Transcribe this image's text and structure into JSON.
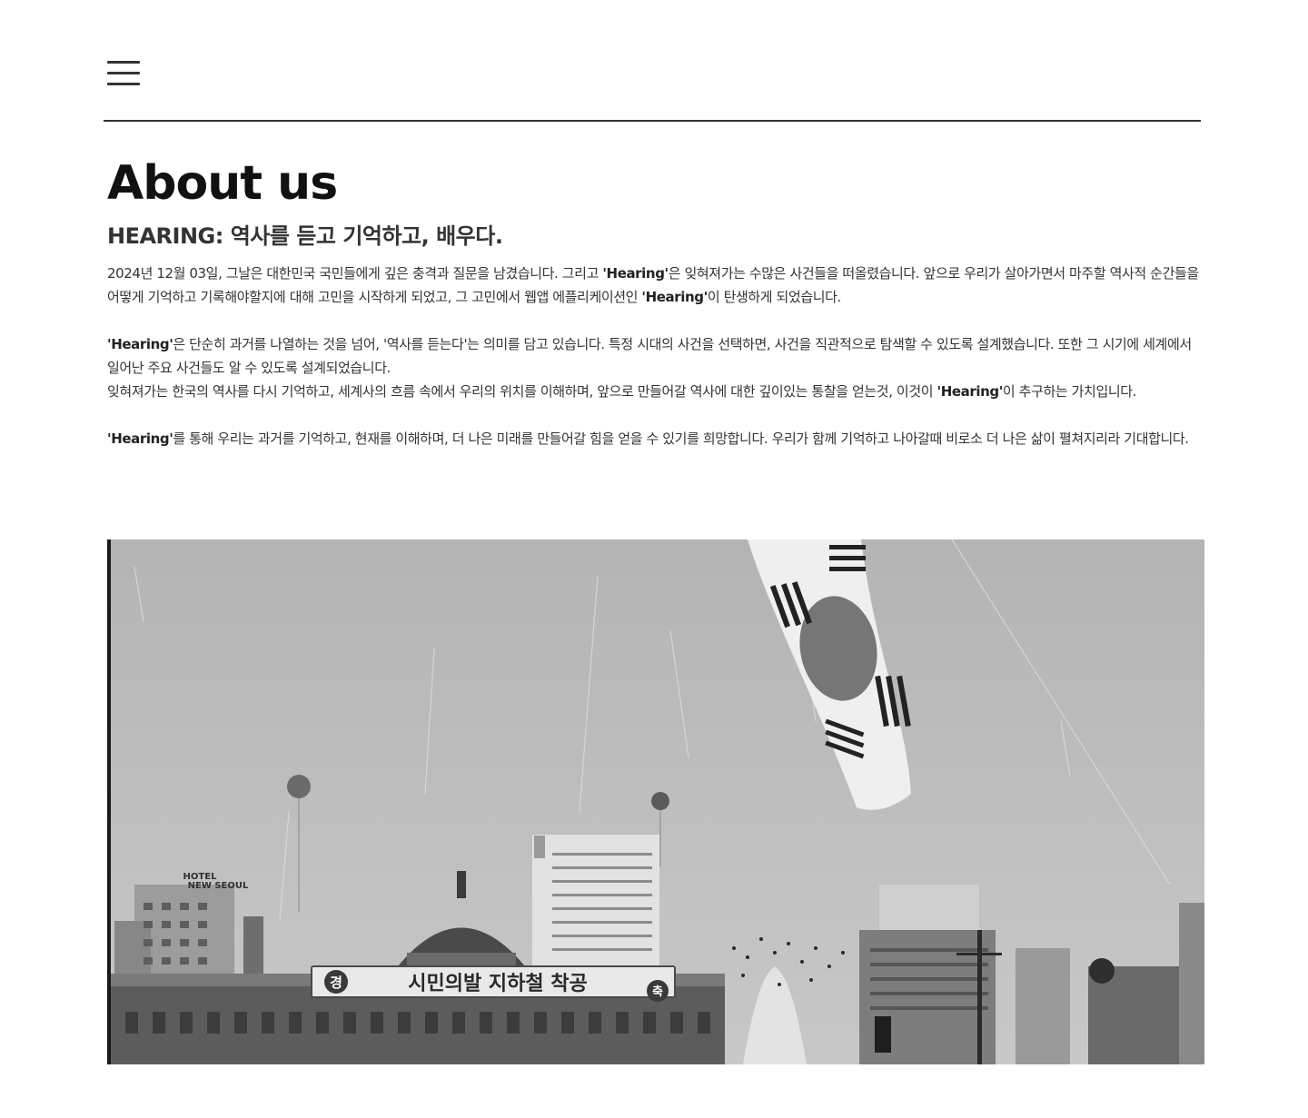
{
  "header": {
    "menu_icon": "hamburger-menu-icon"
  },
  "about": {
    "title": "About us",
    "subtitle": "HEARING: 역사를 듣고 기억하고, 배우다.",
    "p1": {
      "t1": "2024년 12월 03일, 그날은 대한민국 국민들에게 깊은 충격과 질문을 남겼습니다. 그리고 ",
      "b1": "'Hearing'",
      "t2": "은 잊혀져가는 수많은 사건들을 떠올렸습니다. 앞으로 우리가 살아가면서 마주할 역사적 순간들을 어떻게 기억하고 기록해야할지에 대해 고민을 시작하게 되었고, 그 고민에서 웹앱 에플리케이션인 ",
      "b2": "'Hearing'",
      "t3": "이 탄생하게 되었습니다."
    },
    "p2": {
      "b1": "'Hearing'",
      "t1": "은 단순히 과거를 나열하는 것을 넘어, '역사를 듣는다'는 의미를 담고 있습니다. 특정 시대의 사건을 선택하면, 사건을 직관적으로 탐색할 수 있도록 설계했습니다. 또한 그 시기에 세계에서 일어난 주요 사건들도 알 수 있도록 설계되었습니다."
    },
    "p3": {
      "t1": "잊혀져가는 한국의 역사를 다시 기억하고, 세계사의 흐름 속에서 우리의 위치를 이해하며, 앞으로 만들어갈 역사에 대한 깊이있는 통찰을 얻는것, 이것이 ",
      "b1": "'Hearing'",
      "t2": "이 추구하는 가치입니다."
    },
    "p4": {
      "b1": "'Hearing'",
      "t1": "를 통해 우리는 과거를 기억하고, 현재를 이해하며, 더 나은 미래를 만들어갈 힘을 얻을 수 있기를 희망합니다. 우리가 함께 기억하고 나아갈때 비로소 더 나은 삶이 펼쳐지리라 기대합니다."
    }
  },
  "photo": {
    "hotel_sign_line1": "HOTEL",
    "hotel_sign_line2": "NEW SEOUL",
    "banner_left": "경",
    "banner_main": "시민의발 지하철 착공",
    "banner_right": "축",
    "colors": {
      "sky": "#bdbdbd",
      "building_dark": "#5a5a5a",
      "building_mid": "#8a8a8a",
      "flag_red": "#7a7a7a"
    }
  }
}
